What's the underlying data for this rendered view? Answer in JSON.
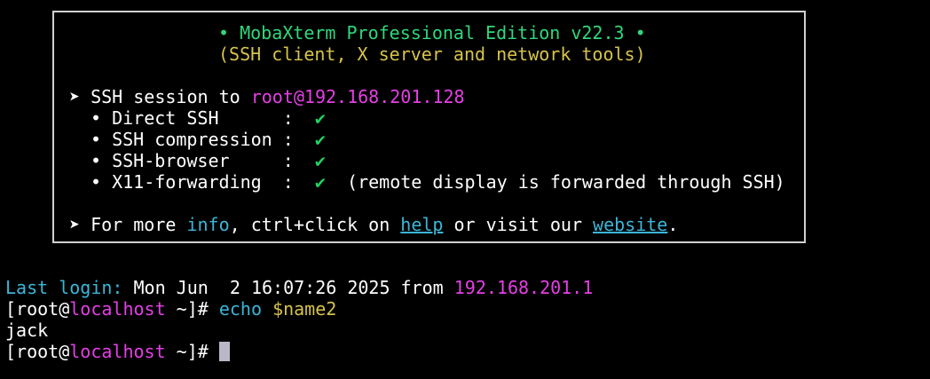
{
  "banner": {
    "title": "• MobaXterm Professional Edition v22.3 •",
    "subtitle": "(SSH client, X server and network tools)",
    "session_prefix": "➤ SSH session to ",
    "session_target": "root@192.168.201.128",
    "features": [
      {
        "bullet": "•",
        "label": "Direct SSH      :",
        "check": "✔",
        "note": ""
      },
      {
        "bullet": "•",
        "label": "SSH compression :",
        "check": "✔",
        "note": ""
      },
      {
        "bullet": "•",
        "label": "SSH-browser     :",
        "check": "✔",
        "note": ""
      },
      {
        "bullet": "•",
        "label": "X11-forwarding  :",
        "check": "✔",
        "note": "(remote display is forwarded through SSH)"
      }
    ],
    "more_prefix": "➤ For more ",
    "more_info": "info",
    "more_mid": ", ctrl+click on ",
    "more_help": "help",
    "more_mid2": " or visit our ",
    "more_website": "website",
    "more_end": "."
  },
  "terminal": {
    "last_login_label": "Last login:",
    "last_login_date": " Mon Jun  2 16:07:26 2025 from ",
    "last_login_ip": "192.168.201.1",
    "prompt1_open": "[root@",
    "prompt1_host": "localhost",
    "prompt1_close": " ~]# ",
    "command1": "echo",
    "command1_arg": "$name2",
    "output1": "jack",
    "prompt2_open": "[root@",
    "prompt2_host": "localhost",
    "prompt2_close": " ~]# "
  },
  "colors": {
    "background": "#000000",
    "title_green": "#2fd87a",
    "subtitle_yellow": "#d7c34a",
    "magenta": "#e53fe5",
    "cyan": "#3bb6d8",
    "check_green": "#22d060"
  }
}
